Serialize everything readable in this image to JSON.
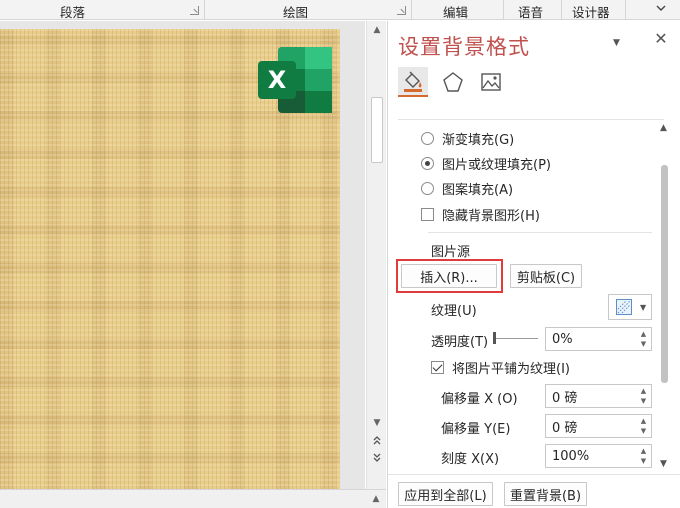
{
  "ribbon": {
    "groups": [
      "段落",
      "绘图",
      "编辑",
      "语音",
      "设计器"
    ]
  },
  "pane": {
    "title": "设置背景格式",
    "tabs": [
      "fill-icon",
      "pentagon-icon",
      "picture-icon"
    ],
    "fill_options": [
      {
        "label": "渐变填充(G)",
        "selected": false
      },
      {
        "label": "图片或纹理填充(P)",
        "selected": true
      },
      {
        "label": "图案填充(A)",
        "selected": false
      }
    ],
    "hide_graphics": {
      "label": "隐藏背景图形(H)",
      "checked": false
    },
    "picture_source": {
      "label": "图片源",
      "insert_button": "插入(R)...",
      "clipboard_button": "剪贴板(C)"
    },
    "texture_label": "纹理(U)",
    "transparency": {
      "label": "透明度(T)",
      "value": "0%"
    },
    "tile": {
      "label": "将图片平铺为纹理(I)",
      "checked": true
    },
    "offset_x": {
      "label": "偏移量 X (O)",
      "value": "0 磅"
    },
    "offset_y": {
      "label": "偏移量 Y(E)",
      "value": "0 磅"
    },
    "scale_x": {
      "label": "刻度 X(X)",
      "value": "100%"
    },
    "apply_all_button": "应用到全部(L)",
    "reset_button": "重置背景(B)"
  },
  "colors": {
    "title_accent": "#c0504d",
    "highlight_box": "#e03c3c",
    "slide_texture": "#e9cd8c"
  }
}
